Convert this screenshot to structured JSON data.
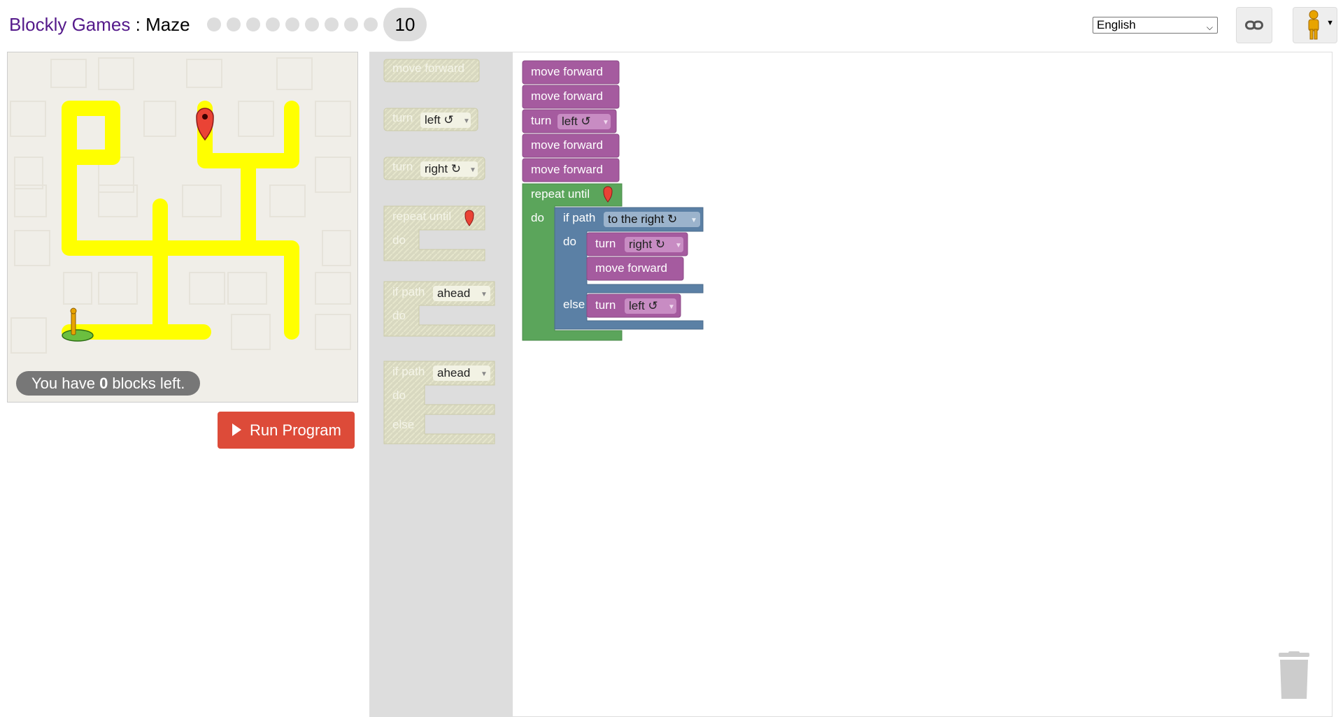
{
  "header": {
    "app_name": "Blockly Games",
    "separator": " : ",
    "game_name": "Maze",
    "level_dots_count": 9,
    "current_level": "10",
    "language": "English",
    "link_icon": "link-icon",
    "pegman_icon": "pegman-icon"
  },
  "maze": {
    "capacity_prefix": "You have ",
    "capacity_count": "0",
    "capacity_suffix": " blocks left.",
    "path_color": "#ffff00",
    "marker_icon": "map-marker-icon",
    "player_icon": "pegman-icon"
  },
  "run_button": {
    "label": "Run Program",
    "icon": "play-icon"
  },
  "toolbox": {
    "move_forward": "move forward",
    "turn": "turn",
    "left": "left ↺",
    "right": "right ↻",
    "repeat_until": "repeat until",
    "do": "do",
    "if_path": "if path",
    "ahead": "ahead",
    "else": "else"
  },
  "program": {
    "move_forward": "move forward",
    "turn": "turn",
    "left": "left ↺",
    "right": "right ↻",
    "repeat_until": "repeat until",
    "do": "do",
    "if_path": "if path",
    "to_the_right": "to the right ↻",
    "else": "else"
  },
  "colors": {
    "movement_block": "#a55b9f",
    "loop_block": "#5ba55b",
    "logic_block": "#5b80a5",
    "run_button": "#dd4b39",
    "title_link": "#551a8b"
  },
  "trash_icon": "trash-can-icon"
}
